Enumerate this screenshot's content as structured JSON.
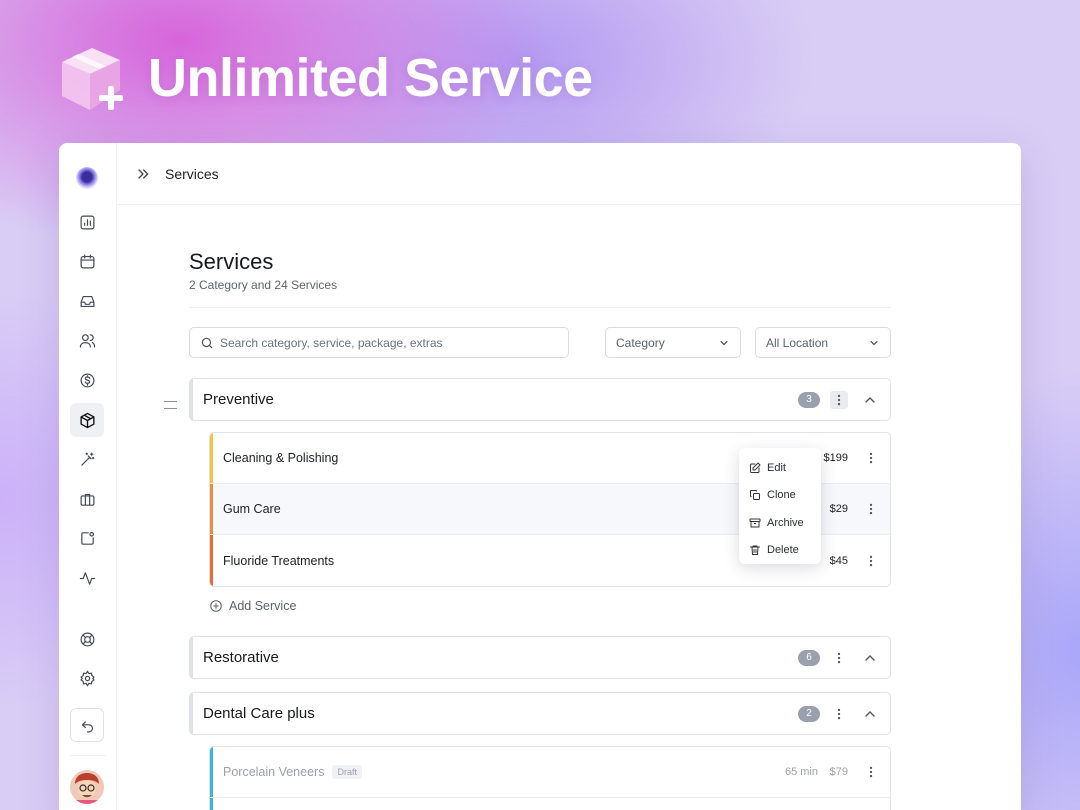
{
  "hero": {
    "title": "Unlimited Service"
  },
  "topbar": {
    "breadcrumb": "Services"
  },
  "page": {
    "title": "Services",
    "subtitle": "2 Category and 24 Services"
  },
  "filters": {
    "search_placeholder": "Search category, service, package, extras",
    "category_label": "Category",
    "location_label": "All Location"
  },
  "categories": [
    {
      "name": "Preventive",
      "count": "3",
      "services": [
        {
          "name": "Cleaning & Polishing",
          "price": "$199",
          "color": "#f5c342"
        },
        {
          "name": "Gum Care",
          "price": "$29",
          "color": "#f08a3c"
        },
        {
          "name": "Fluoride Treatments",
          "price": "$45",
          "color": "#ec6a2e"
        }
      ],
      "add_label": "Add Service"
    },
    {
      "name": "Restorative",
      "count": "6"
    },
    {
      "name": "Dental Care plus",
      "count": "2",
      "services": [
        {
          "name": "Porcelain Veneers",
          "badge": "Draft",
          "duration": "65 min",
          "price": "$79",
          "color": "#3bb3d6"
        }
      ]
    }
  ],
  "context_menu": {
    "items": [
      {
        "label": "Edit",
        "icon": "edit-icon"
      },
      {
        "label": "Clone",
        "icon": "clone-icon"
      },
      {
        "label": "Archive",
        "icon": "archive-icon"
      },
      {
        "label": "Delete",
        "icon": "trash-icon"
      }
    ]
  },
  "colors": {
    "accent": "#6a5ae0",
    "active_row": "#f6f8fb"
  }
}
